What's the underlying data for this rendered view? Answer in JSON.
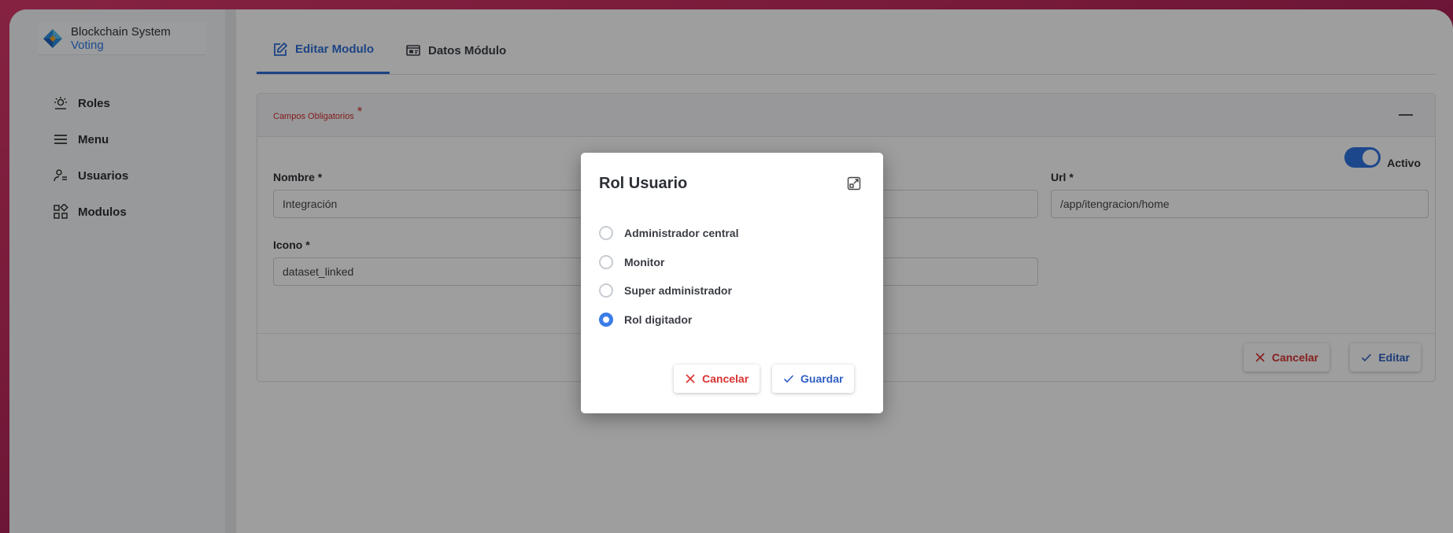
{
  "brand": {
    "name": "Blockchain System",
    "accent": "Voting"
  },
  "sidebar": {
    "items": [
      {
        "label": "Roles",
        "icon": "roles-icon"
      },
      {
        "label": "Menu",
        "icon": "menu-icon"
      },
      {
        "label": "Usuarios",
        "icon": "users-icon"
      },
      {
        "label": "Modulos",
        "icon": "modules-icon"
      }
    ]
  },
  "tabs": [
    {
      "label": "Editar Modulo",
      "icon": "edit-icon",
      "active": true
    },
    {
      "label": "Datos Módulo",
      "icon": "data-icon",
      "active": false
    }
  ],
  "form": {
    "required_label": "Campos Obligatorios",
    "required_star": "*",
    "toggle": {
      "label": "Activo",
      "on": true
    },
    "nombre": {
      "label": "Nombre *",
      "value": "Integración"
    },
    "url": {
      "label": "Url *",
      "value": "/app/itengracion/home"
    },
    "icono": {
      "label": "Icono *",
      "value": "dataset_linked"
    },
    "cancel_label": "Cancelar",
    "edit_label": "Editar"
  },
  "modal": {
    "title": "Rol Usuario",
    "options": [
      {
        "label": "Administrador central",
        "checked": false
      },
      {
        "label": "Monitor",
        "checked": false
      },
      {
        "label": "Super administrador",
        "checked": false
      },
      {
        "label": "Rol digitador",
        "checked": true
      }
    ],
    "cancel_label": "Cancelar",
    "save_label": "Guardar"
  },
  "colors": {
    "primary": "#2f6fd6",
    "danger": "#d93232",
    "overlay": "rgba(0,0,0,0.38)"
  }
}
